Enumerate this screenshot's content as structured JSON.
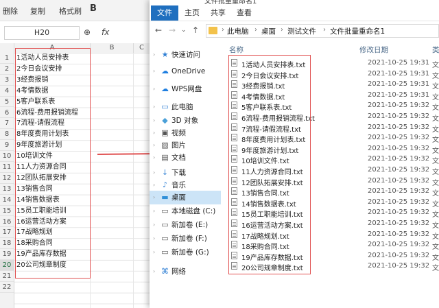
{
  "spreadsheet": {
    "toolbar": {
      "delete_label": "删除",
      "copy_label": "复制",
      "format_brush_label": "格式刷",
      "bold_label": "B"
    },
    "name_box": "H20",
    "fx_label": "fx",
    "columns": [
      "A",
      "B",
      "C"
    ],
    "rows": [
      "1",
      "2",
      "3",
      "4",
      "5",
      "6",
      "7",
      "8",
      "9",
      "10",
      "11",
      "12",
      "13",
      "14",
      "15",
      "16",
      "17",
      "18",
      "19",
      "20",
      "21",
      "22"
    ],
    "cells": [
      "1活动人员安排表",
      "2今日会议安排",
      "3经费报销",
      "4考情数据",
      "5客户联系表",
      "6流程-费用报销流程",
      "7流程-请假流程",
      "8年度费用计划表",
      "9年度旅游计划",
      "10培训文件",
      "11人力资源合同",
      "12团队拓展安排",
      "13销售合同",
      "14销售数据表",
      "15员工职能培训",
      "16运营活动方案",
      "17战略规划",
      "18采购合同",
      "19产品库存数据",
      "20公司规章制度"
    ]
  },
  "explorer": {
    "title": "文件批量重命名1",
    "ribbon_tabs": [
      "文件",
      "主页",
      "共享",
      "查看"
    ],
    "breadcrumbs": [
      "此电脑",
      "桌面",
      "测试文件",
      "文件批量重命名1"
    ],
    "nav_items": [
      {
        "icon": "star-icon",
        "label": "快速访问"
      },
      {
        "icon": "cloud-icon",
        "label": "OneDrive"
      },
      {
        "icon": "cloud-icon",
        "label": "WPS网盘"
      },
      {
        "icon": "computer-icon",
        "label": "此电脑"
      },
      {
        "icon": "cube-icon",
        "label": "3D 对象"
      },
      {
        "icon": "video-icon",
        "label": "视频"
      },
      {
        "icon": "picture-icon",
        "label": "图片"
      },
      {
        "icon": "document-icon",
        "label": "文档"
      },
      {
        "icon": "download-icon",
        "label": "下载"
      },
      {
        "icon": "music-icon",
        "label": "音乐"
      },
      {
        "icon": "desktop-icon",
        "label": "桌面"
      },
      {
        "icon": "drive-icon",
        "label": "本地磁盘 (C:)"
      },
      {
        "icon": "drive-icon",
        "label": "新加卷 (E:)"
      },
      {
        "icon": "drive-icon",
        "label": "新加卷 (F:)"
      },
      {
        "icon": "drive-icon",
        "label": "新加卷 (G:)"
      },
      {
        "icon": "network-icon",
        "label": "网络"
      }
    ],
    "columns": {
      "name": "名称",
      "date": "修改日期",
      "type": "类"
    },
    "files": [
      {
        "name": "1活动人员安排表.txt",
        "date": "2021-10-25 19:31",
        "type": "文"
      },
      {
        "name": "2今日会议安排.txt",
        "date": "2021-10-25 19:31",
        "type": "文"
      },
      {
        "name": "3经费报销.txt",
        "date": "2021-10-25 19:31",
        "type": "文"
      },
      {
        "name": "4考情数据.txt",
        "date": "2021-10-25 19:31",
        "type": "文"
      },
      {
        "name": "5客户联系表.txt",
        "date": "2021-10-25 19:32",
        "type": "文"
      },
      {
        "name": "6流程-费用报销流程.txt",
        "date": "2021-10-25 19:32",
        "type": "文"
      },
      {
        "name": "7流程-请假流程.txt",
        "date": "2021-10-25 19:32",
        "type": "文"
      },
      {
        "name": "8年度费用计划表.txt",
        "date": "2021-10-25 19:32",
        "type": "文"
      },
      {
        "name": "9年度旅游计划.txt",
        "date": "2021-10-25 19:32",
        "type": "文"
      },
      {
        "name": "10培训文件.txt",
        "date": "2021-10-25 19:32",
        "type": "文"
      },
      {
        "name": "11人力资源合同.txt",
        "date": "2021-10-25 19:32",
        "type": "文"
      },
      {
        "name": "12团队拓展安排.txt",
        "date": "2021-10-25 19:32",
        "type": "文"
      },
      {
        "name": "13销售合同.txt",
        "date": "2021-10-25 19:32",
        "type": "文"
      },
      {
        "name": "14销售数据表.txt",
        "date": "2021-10-25 19:32",
        "type": "文"
      },
      {
        "name": "15员工职能培训.txt",
        "date": "2021-10-25 19:32",
        "type": "文"
      },
      {
        "name": "16运营活动方案.txt",
        "date": "2021-10-25 19:32",
        "type": "文"
      },
      {
        "name": "17战略规划.txt",
        "date": "2021-10-25 19:32",
        "type": "文"
      },
      {
        "name": "18采购合同.txt",
        "date": "2021-10-25 19:32",
        "type": "文"
      },
      {
        "name": "19产品库存数据.txt",
        "date": "2021-10-25 19:32",
        "type": "文"
      },
      {
        "name": "20公司规章制度.txt",
        "date": "2021-10-25 19:32",
        "type": "文"
      }
    ]
  },
  "colors": {
    "highlight_box": "#e05050",
    "file_tab": "#1f6fbf",
    "selected_nav": "#cce4f7"
  }
}
